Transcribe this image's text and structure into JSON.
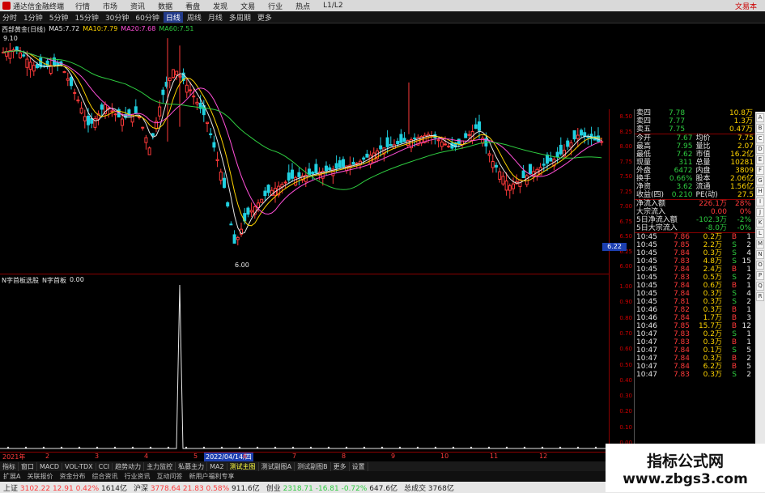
{
  "menubar": {
    "app_title": "通达信金融终端",
    "items": [
      "行情",
      "市场",
      "资讯",
      "数据",
      "看盘",
      "发现",
      "文易",
      "行业",
      "热点",
      "L1/L2"
    ],
    "right": "文易本"
  },
  "toolbar": {
    "items": [
      "分时",
      "1分钟",
      "5分钟",
      "15分钟",
      "30分钟",
      "60分钟",
      "日线",
      "周线",
      "月线",
      "多周期",
      "更多"
    ],
    "active_index": 6
  },
  "kchart": {
    "title": {
      "name": "西部黄金(日线)",
      "ma": [
        {
          "label": "MA5:",
          "value": "7.72",
          "color": "#e6e6e6"
        },
        {
          "label": "MA10:",
          "value": "7.79",
          "color": "#ffd400"
        },
        {
          "label": "MA20:",
          "value": "7.68",
          "color": "#ff4fd8"
        },
        {
          "label": "MA60:",
          "value": "7.51",
          "color": "#2ecc40"
        }
      ]
    },
    "high_label": "9.10",
    "low_label": "6.00",
    "axis": [
      "8.50",
      "8.25",
      "8.00",
      "7.75",
      "7.50",
      "7.25",
      "7.00",
      "6.75",
      "6.50",
      "6.25",
      "6.00"
    ],
    "price_tag": "6.22",
    "chart_data": {
      "type": "candlestick",
      "ylim": [
        6.0,
        9.2
      ],
      "ma_series": [
        {
          "name": "MA5",
          "color": "#e6e6e6"
        },
        {
          "name": "MA10",
          "color": "#ffd400"
        },
        {
          "name": "MA20",
          "color": "#ff4fd8"
        },
        {
          "name": "MA60",
          "color": "#2ecc40"
        }
      ]
    }
  },
  "indicator": {
    "title_name": "N字首板选股",
    "title_line": "N字首板",
    "title_value": "0.00",
    "axis": [
      "1.00",
      "0.90",
      "0.80",
      "0.70",
      "0.60",
      "0.50",
      "0.40",
      "0.30",
      "0.20",
      "0.10",
      "0.00"
    ],
    "date_start": "2021年",
    "months": [
      "2",
      "3",
      "4",
      "5",
      "6",
      "7",
      "8",
      "9",
      "10",
      "11",
      "12"
    ],
    "cursor_date": "2022/04/14/四",
    "chart_data": {
      "type": "line",
      "ylim": [
        0,
        1
      ],
      "spike_value": 1.0
    }
  },
  "quote": {
    "asks": [
      {
        "label": "卖四",
        "price": "7.78",
        "vol": "10.8万"
      },
      {
        "label": "卖四",
        "price": "7.77",
        "vol": "1.3万"
      },
      {
        "label": "卖五",
        "price": "7.75",
        "vol": "0.47万"
      }
    ],
    "stats": [
      {
        "l1": "今开",
        "v1": "7.67",
        "l2": "均价",
        "v2": "7.75"
      },
      {
        "l1": "最高",
        "v1": "7.95",
        "l2": "量比",
        "v2": "2.07"
      },
      {
        "l1": "最低",
        "v1": "7.62",
        "l2": "市值",
        "v2": "16.2亿"
      },
      {
        "l1": "现量",
        "v1": "311",
        "l2": "总量",
        "v2": "10281"
      },
      {
        "l1": "外盘",
        "v1": "6472",
        "l2": "内盘",
        "v2": "3809"
      },
      {
        "l1": "换手",
        "v1": "0.66%",
        "l2": "股本",
        "v2": "2.06亿"
      },
      {
        "l1": "净资",
        "v1": "3.62",
        "l2": "流通",
        "v2": "1.56亿"
      },
      {
        "l1": "收益(四)",
        "v1": "0.210",
        "l2": "PE(动)",
        "v2": "27.5"
      }
    ],
    "flows": [
      {
        "label": "净流入额",
        "value": "226.1万",
        "pct": "28%"
      },
      {
        "label": "大宗流入",
        "value": "0.00",
        "pct": "0%"
      },
      {
        "label": "5日净流入额",
        "value": "-102.3万",
        "pct": "-2%"
      },
      {
        "label": "5日大宗流入",
        "value": "-8.0万",
        "pct": "-0%"
      }
    ],
    "ticks": [
      {
        "t": "10:45",
        "p": "7.86",
        "v": "0.2万",
        "s": "B",
        "n": "1"
      },
      {
        "t": "10:45",
        "p": "7.85",
        "v": "2.2万",
        "s": "S",
        "n": "2"
      },
      {
        "t": "10:45",
        "p": "7.84",
        "v": "0.3万",
        "s": "S",
        "n": "4"
      },
      {
        "t": "10:45",
        "p": "7.83",
        "v": "4.8万",
        "s": "S",
        "n": "15"
      },
      {
        "t": "10:45",
        "p": "7.84",
        "v": "2.4万",
        "s": "B",
        "n": "1"
      },
      {
        "t": "10:45",
        "p": "7.83",
        "v": "0.5万",
        "s": "S",
        "n": "2"
      },
      {
        "t": "10:45",
        "p": "7.84",
        "v": "0.6万",
        "s": "B",
        "n": "1"
      },
      {
        "t": "10:45",
        "p": "7.84",
        "v": "0.3万",
        "s": "S",
        "n": "4"
      },
      {
        "t": "10:45",
        "p": "7.81",
        "v": "0.3万",
        "s": "S",
        "n": "2"
      },
      {
        "t": "10:46",
        "p": "7.82",
        "v": "0.3万",
        "s": "B",
        "n": "1"
      },
      {
        "t": "10:46",
        "p": "7.84",
        "v": "1.7万",
        "s": "B",
        "n": "3"
      },
      {
        "t": "10:46",
        "p": "7.85",
        "v": "15.7万",
        "s": "B",
        "n": "12"
      },
      {
        "t": "10:47",
        "p": "7.83",
        "v": "0.2万",
        "s": "S",
        "n": "1"
      },
      {
        "t": "10:47",
        "p": "7.83",
        "v": "0.3万",
        "s": "B",
        "n": "1"
      },
      {
        "t": "10:47",
        "p": "7.84",
        "v": "0.1万",
        "s": "S",
        "n": "5"
      },
      {
        "t": "10:47",
        "p": "7.84",
        "v": "0.3万",
        "s": "B",
        "n": "2"
      },
      {
        "t": "10:47",
        "p": "7.84",
        "v": "6.2万",
        "s": "B",
        "n": "5"
      },
      {
        "t": "10:47",
        "p": "7.83",
        "v": "0.3万",
        "s": "S",
        "n": "2"
      }
    ]
  },
  "tabs1": [
    "指标",
    "窗口",
    "MACD",
    "VOL-TDX",
    "CCI",
    "趋势动力",
    "主力监控",
    "私募主力",
    "MA2",
    "测试主图",
    "测试副图A",
    "测试副图B",
    "更多",
    "设置"
  ],
  "tabs1_active": 9,
  "tabs2": [
    "扩展A",
    "关联报价",
    "资金分布",
    "综合资讯",
    "行业资讯",
    "互动问答",
    "新用户福利专享"
  ],
  "status": [
    {
      "label": "上证",
      "value": "3102.22",
      "chg": "12.91",
      "pct": "0.42%",
      "amt": "1614亿"
    },
    {
      "label": "沪深",
      "value": "3778.64",
      "chg": "21.83",
      "pct": "0.58%",
      "amt": "911.6亿"
    },
    {
      "label": "创业",
      "value": "2318.71",
      "chg": "-16.81",
      "pct": "-0.72%",
      "amt": "647.6亿"
    }
  ],
  "status_extra": {
    "label": "总成交",
    "value": "3768亿"
  },
  "status_right": "平安证券 上海 上证云行情",
  "watermark": {
    "line1": "指标公式网",
    "line2": "www.zbgs3.com"
  },
  "side_icons": [
    "A",
    "B",
    "C",
    "D",
    "E",
    "F",
    "G",
    "H",
    "I",
    "J",
    "K",
    "L",
    "M",
    "N",
    "O",
    "P",
    "Q",
    "R"
  ]
}
